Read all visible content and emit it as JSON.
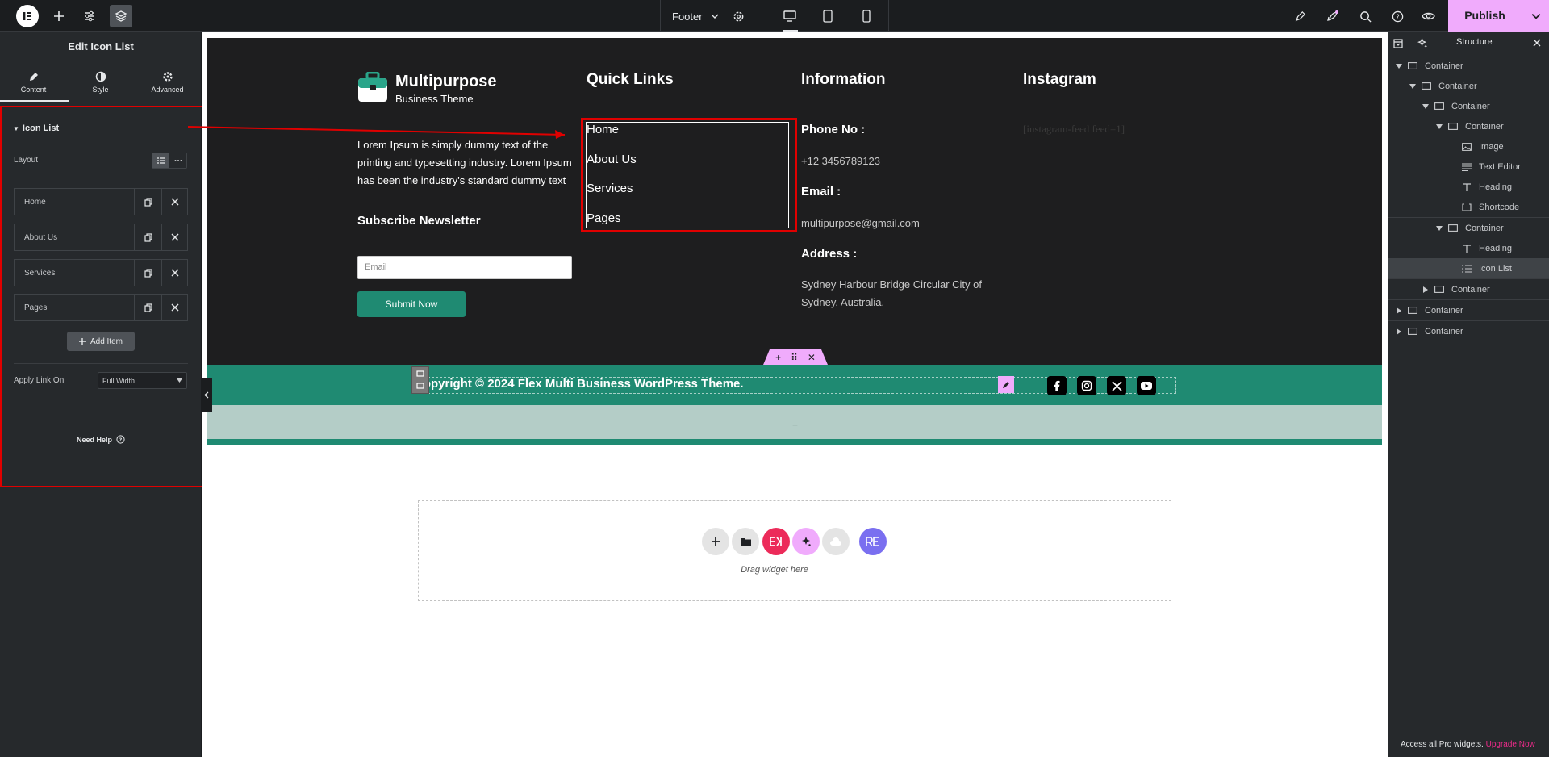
{
  "topbar": {
    "template_name": "Footer",
    "publish_label": "Publish"
  },
  "left_panel": {
    "title": "Edit Icon List",
    "tabs": [
      {
        "label": "Content"
      },
      {
        "label": "Style"
      },
      {
        "label": "Advanced"
      }
    ],
    "section_title": "Icon List",
    "layout_label": "Layout",
    "items": [
      {
        "label": "Home"
      },
      {
        "label": "About Us"
      },
      {
        "label": "Services"
      },
      {
        "label": "Pages"
      }
    ],
    "add_item_label": "Add Item",
    "apply_link_label": "Apply Link On",
    "apply_link_value": "Full Width",
    "need_help_label": "Need Help"
  },
  "canvas": {
    "brand_name": "Multipurpose",
    "brand_sub": "Business Theme",
    "about_text": "Lorem Ipsum is simply dummy text of the printing and typesetting industry. Lorem Ipsum has been the industry's standard dummy text",
    "newsletter_heading": "Subscribe Newsletter",
    "email_placeholder": "Email",
    "submit_label": "Submit Now",
    "quick_links_heading": "Quick Links",
    "quick_links": [
      "Home",
      "About Us",
      "Services",
      "Pages"
    ],
    "information_heading": "Information",
    "phone_label": "Phone No :",
    "phone_value": "+12 3456789123",
    "email_label": "Email :",
    "email_value": "multipurpose@gmail.com",
    "address_label": "Address :",
    "address_value": "Sydney Harbour Bridge Circular City of Sydney, Australia.",
    "instagram_heading": "Instagram",
    "instagram_shortcode": "[instagram-feed feed=1]",
    "copyright": "Copyright © 2024 Flex Multi Business WordPress Theme.",
    "drag_text": "Drag widget here"
  },
  "structure": {
    "title": "Structure",
    "rows": [
      {
        "label": "Container",
        "icon": "container-icon",
        "expanded": true
      },
      {
        "label": "Container",
        "icon": "container-icon",
        "expanded": true
      },
      {
        "label": "Container",
        "icon": "container-icon",
        "expanded": true
      },
      {
        "label": "Container",
        "icon": "container-icon",
        "expanded": true
      },
      {
        "label": "Image",
        "icon": "image-icon"
      },
      {
        "label": "Text Editor",
        "icon": "text-editor-icon"
      },
      {
        "label": "Heading",
        "icon": "heading-icon"
      },
      {
        "label": "Shortcode",
        "icon": "shortcode-icon"
      },
      {
        "label": "Container",
        "icon": "container-icon",
        "expanded": true
      },
      {
        "label": "Heading",
        "icon": "heading-icon"
      },
      {
        "label": "Icon List",
        "icon": "icon-list-icon",
        "selected": true
      },
      {
        "label": "Container",
        "icon": "container-icon",
        "expanded": false
      },
      {
        "label": "Container",
        "icon": "container-icon",
        "expanded": false
      },
      {
        "label": "Container",
        "icon": "container-icon",
        "expanded": false
      }
    ],
    "pro_note": "Access all Pro widgets.",
    "upgrade_label": "Upgrade Now"
  },
  "colors": {
    "accent_pink": "#f0abfc",
    "brand_green": "#1f8a72",
    "selection_red": "#e00000"
  }
}
